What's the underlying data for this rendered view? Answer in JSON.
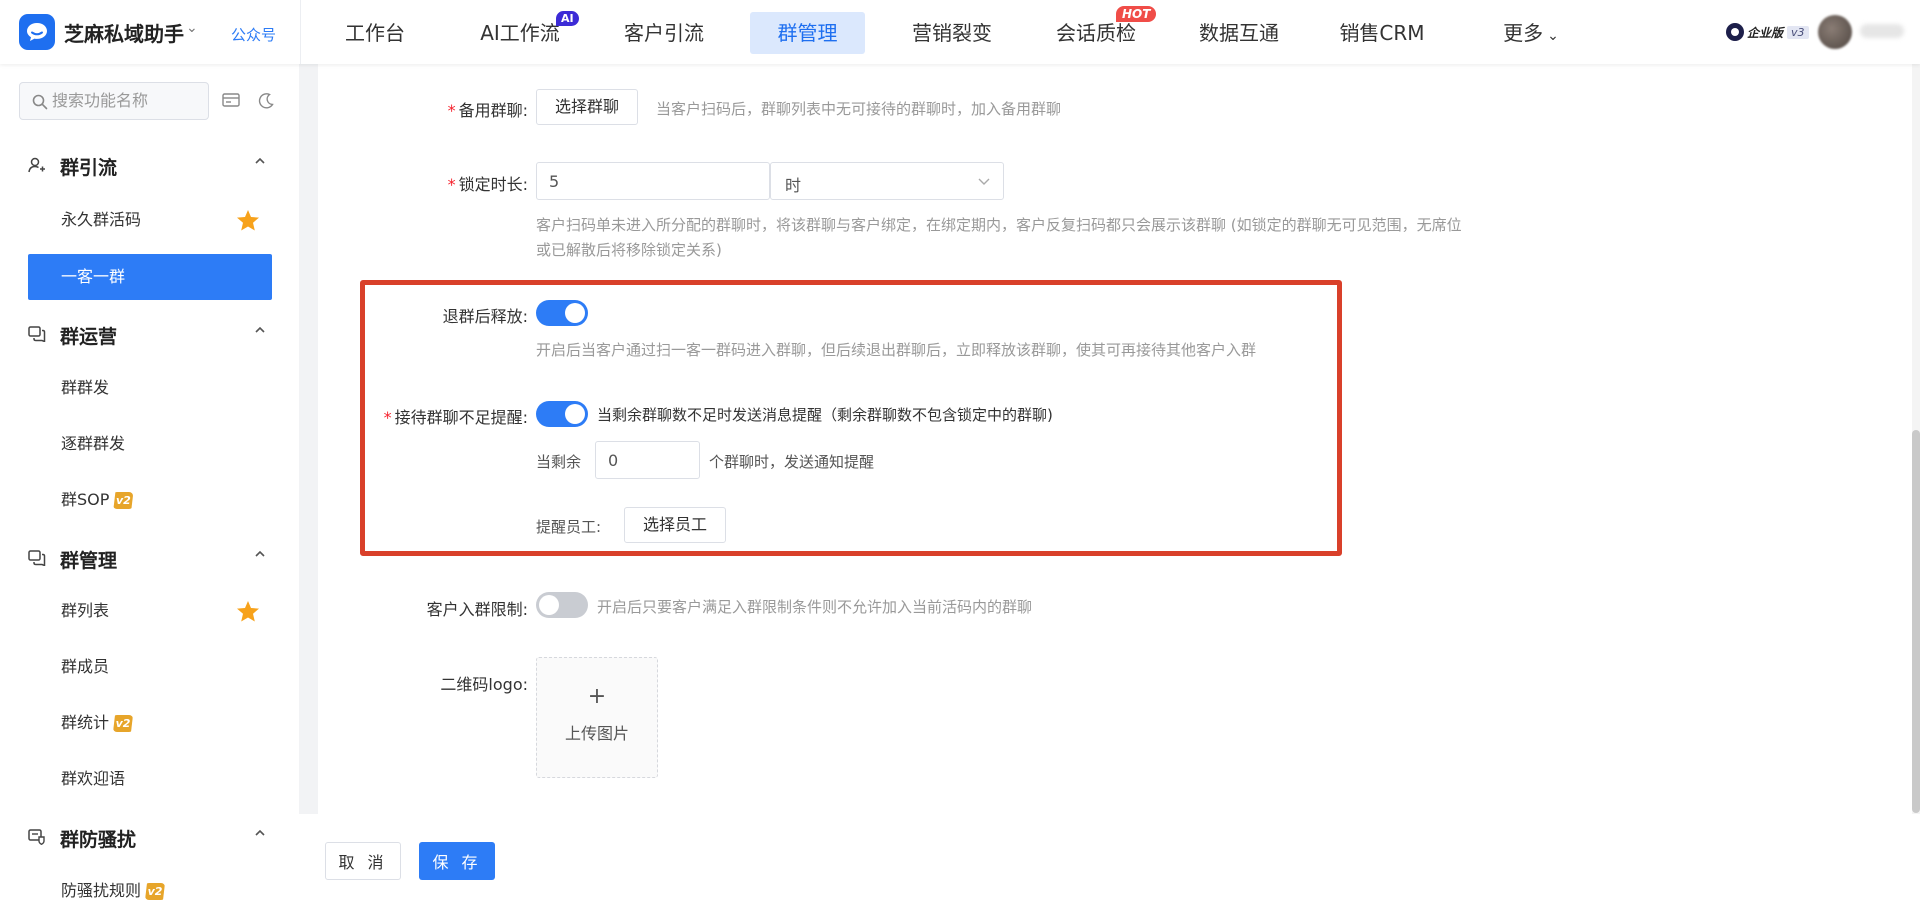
{
  "header": {
    "brand": "芝麻私域助手",
    "account_link": "公众号",
    "nav": [
      {
        "label": "工作台"
      },
      {
        "label": "AI工作流",
        "badge": "AI"
      },
      {
        "label": "客户引流"
      },
      {
        "label": "群管理",
        "active": true
      },
      {
        "label": "营销裂变"
      },
      {
        "label": "会话质检",
        "badge": "HOT"
      },
      {
        "label": "数据互通"
      },
      {
        "label": "销售CRM"
      },
      {
        "label": "更多"
      }
    ],
    "edition": "企业版",
    "edition_version": "v3"
  },
  "sidebar": {
    "search_placeholder": "搜索功能名称",
    "groups": [
      {
        "title": "群引流",
        "items": [
          {
            "label": "永久群活码",
            "starred": true
          },
          {
            "label": "一客一群",
            "active": true
          }
        ]
      },
      {
        "title": "群运营",
        "items": [
          {
            "label": "群群发"
          },
          {
            "label": "逐群群发"
          },
          {
            "label": "群SOP",
            "badge": "v2"
          }
        ]
      },
      {
        "title": "群管理",
        "items": [
          {
            "label": "群列表",
            "starred": true
          },
          {
            "label": "群成员"
          },
          {
            "label": "群统计",
            "badge": "v2"
          },
          {
            "label": "群欢迎语"
          }
        ]
      },
      {
        "title": "群防骚扰",
        "items": [
          {
            "label": "防骚扰规则",
            "badge": "v2"
          }
        ]
      }
    ]
  },
  "form": {
    "backup_group": {
      "label": "备用群聊:",
      "button": "选择群聊",
      "hint": "当客户扫码后，群聊列表中无可接待的群聊时，加入备用群聊"
    },
    "lock_duration": {
      "label": "锁定时长:",
      "value": "5",
      "unit": "时",
      "hint_line1": "客户扫码单未进入所分配的群聊时，将该群聊与客户绑定，在绑定期内，客户反复扫码都只会展示该群聊 (如锁定的群聊无可见范围，无席位",
      "hint_line2": "或已解散后将移除锁定关系)"
    },
    "release_after_quit": {
      "label": "退群后释放:",
      "enabled": true,
      "hint": "开启后当客户通过扫一客一群码进入群聊，但后续退出群聊后，立即释放该群聊，使其可再接待其他客户入群"
    },
    "insufficient_alert": {
      "label": "接待群聊不足提醒:",
      "enabled": true,
      "desc": "当剩余群聊数不足时发送消息提醒（剩余群聊数不包含锁定中的群聊)",
      "remain_prefix": "当剩余",
      "remain_value": "0",
      "remain_suffix": "个群聊时，发送通知提醒",
      "staff_label": "提醒员工:",
      "staff_button": "选择员工"
    },
    "join_limit": {
      "label": "客户入群限制:",
      "enabled": false,
      "hint": "开启后只要客户满足入群限制条件则不允许加入当前活码内的群聊"
    },
    "qr_logo": {
      "label": "二维码logo:",
      "upload_plus": "+",
      "upload_label": "上传图片"
    }
  },
  "footer": {
    "cancel": "取 消",
    "save": "保 存"
  },
  "colors": {
    "primary": "#2d7cf6",
    "highlight": "#d9402a",
    "required": "#f5222d"
  }
}
